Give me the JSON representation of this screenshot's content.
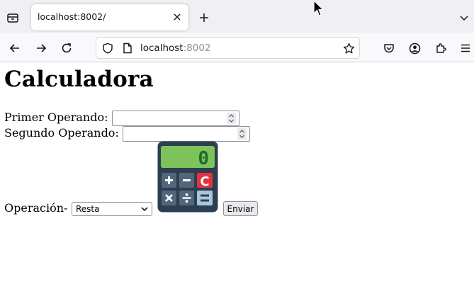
{
  "browser": {
    "tab_title": "localhost:8002/",
    "url_host": "localhost",
    "url_port": ":8002"
  },
  "page": {
    "title": "Calculadora",
    "first_operand_label": "Primer Operando:",
    "first_operand_value": "",
    "second_operand_label": "Segundo Operando:",
    "second_operand_value": "",
    "operation_label": "Operación-",
    "operation_selected": "Resta",
    "calculator_display": "0",
    "submit_label": "Enviar"
  }
}
